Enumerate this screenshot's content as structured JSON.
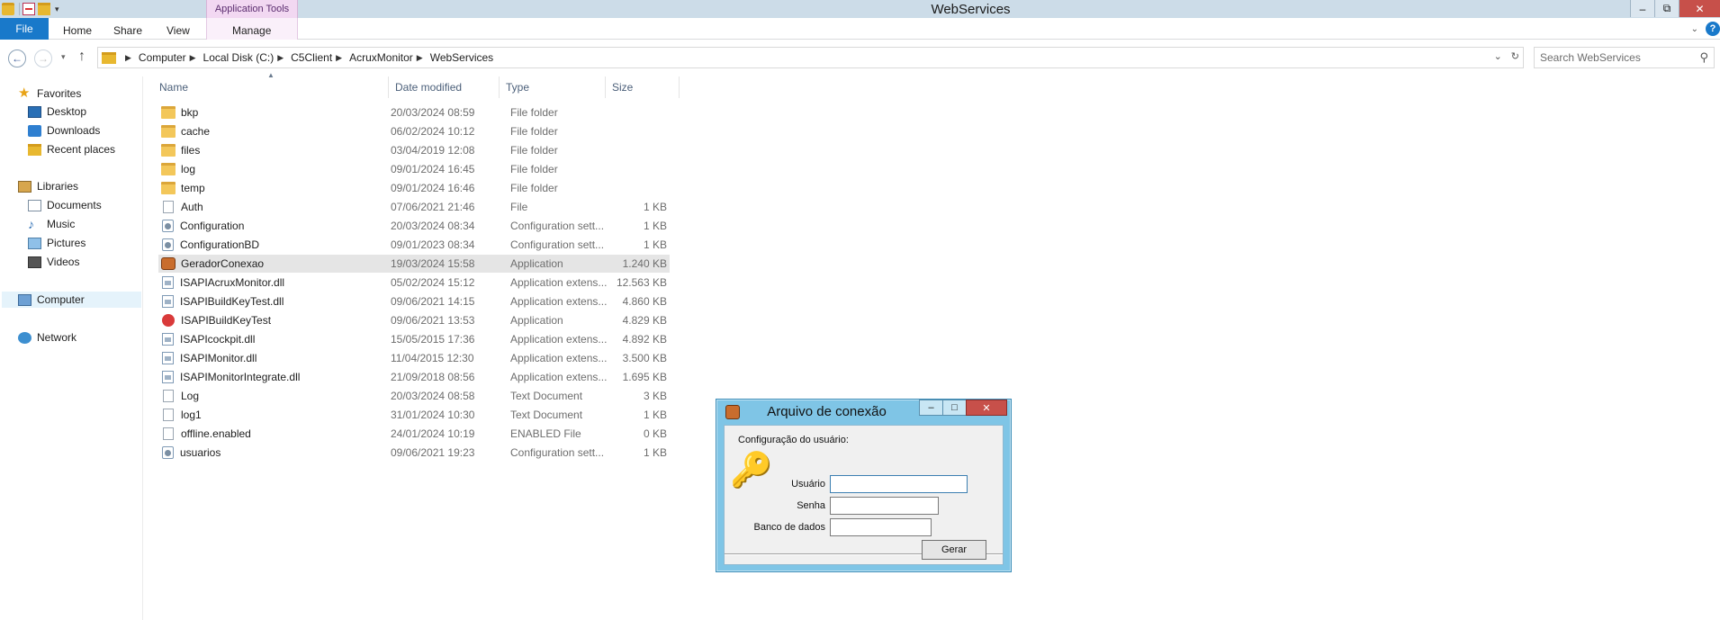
{
  "window": {
    "title": "WebServices",
    "context_tab_group": "Application Tools",
    "buttons": {
      "minimize": "‒",
      "restore": "⧉",
      "close": "✕"
    }
  },
  "ribbon": {
    "tabs": [
      {
        "label": "File"
      },
      {
        "label": "Home"
      },
      {
        "label": "Share"
      },
      {
        "label": "View"
      },
      {
        "label": "Manage"
      }
    ],
    "help": "?",
    "expand": "⌄"
  },
  "nav": {
    "back": "←",
    "forward": "→",
    "recent": "▾",
    "up": "↑",
    "breadcrumb": [
      "Computer",
      "Local Disk (C:)",
      "C5Client",
      "AcruxMonitor",
      "WebServices"
    ],
    "crumb_separator": "▶",
    "refresh": "↻",
    "dropdown": "⌄"
  },
  "search": {
    "placeholder": "Search WebServices",
    "icon": "search-icon"
  },
  "sidebar": {
    "items": [
      {
        "label": "Favorites",
        "icon": "star-icon"
      },
      {
        "label": "Desktop",
        "icon": "desktop-icon"
      },
      {
        "label": "Downloads",
        "icon": "downloads-icon"
      },
      {
        "label": "Recent places",
        "icon": "recent-places-icon"
      },
      {
        "label": "Libraries",
        "icon": "libraries-icon"
      },
      {
        "label": "Documents",
        "icon": "documents-icon"
      },
      {
        "label": "Music",
        "icon": "music-icon"
      },
      {
        "label": "Pictures",
        "icon": "pictures-icon"
      },
      {
        "label": "Videos",
        "icon": "videos-icon"
      },
      {
        "label": "Computer",
        "icon": "computer-icon"
      },
      {
        "label": "Network",
        "icon": "network-icon"
      }
    ]
  },
  "filelist": {
    "columns": [
      "Name",
      "Date modified",
      "Type",
      "Size"
    ],
    "sort_indicator": "▲",
    "rows": [
      {
        "name": "bkp",
        "date": "20/03/2024 08:59",
        "type": "File folder",
        "size": "",
        "icon": "folder"
      },
      {
        "name": "cache",
        "date": "06/02/2024 10:12",
        "type": "File folder",
        "size": "",
        "icon": "folder"
      },
      {
        "name": "files",
        "date": "03/04/2019 12:08",
        "type": "File folder",
        "size": "",
        "icon": "folder"
      },
      {
        "name": "log",
        "date": "09/01/2024 16:45",
        "type": "File folder",
        "size": "",
        "icon": "folder"
      },
      {
        "name": "temp",
        "date": "09/01/2024 16:46",
        "type": "File folder",
        "size": "",
        "icon": "folder"
      },
      {
        "name": "Auth",
        "date": "07/06/2021 21:46",
        "type": "File",
        "size": "1 KB",
        "icon": "file"
      },
      {
        "name": "Configuration",
        "date": "20/03/2024 08:34",
        "type": "Configuration sett...",
        "size": "1 KB",
        "icon": "config"
      },
      {
        "name": "ConfigurationBD",
        "date": "09/01/2023 08:34",
        "type": "Configuration sett...",
        "size": "1 KB",
        "icon": "config"
      },
      {
        "name": "GeradorConexao",
        "date": "19/03/2024 15:58",
        "type": "Application",
        "size": "1.240 KB",
        "icon": "app-key"
      },
      {
        "name": "ISAPIAcruxMonitor.dll",
        "date": "05/02/2024 15:12",
        "type": "Application extens...",
        "size": "12.563 KB",
        "icon": "dll"
      },
      {
        "name": "ISAPIBuildKeyTest.dll",
        "date": "09/06/2021 14:15",
        "type": "Application extens...",
        "size": "4.860 KB",
        "icon": "dll"
      },
      {
        "name": "ISAPIBuildKeyTest",
        "date": "09/06/2021 13:53",
        "type": "Application",
        "size": "4.829 KB",
        "icon": "app-red"
      },
      {
        "name": "ISAPIcockpit.dll",
        "date": "15/05/2015 17:36",
        "type": "Application extens...",
        "size": "4.892 KB",
        "icon": "dll"
      },
      {
        "name": "ISAPIMonitor.dll",
        "date": "11/04/2015 12:30",
        "type": "Application extens...",
        "size": "3.500 KB",
        "icon": "dll"
      },
      {
        "name": "ISAPIMonitorIntegrate.dll",
        "date": "21/09/2018 08:56",
        "type": "Application extens...",
        "size": "1.695 KB",
        "icon": "dll"
      },
      {
        "name": "Log",
        "date": "20/03/2024 08:58",
        "type": "Text Document",
        "size": "3 KB",
        "icon": "file"
      },
      {
        "name": "log1",
        "date": "31/01/2024 10:30",
        "type": "Text Document",
        "size": "1 KB",
        "icon": "file"
      },
      {
        "name": "offline.enabled",
        "date": "24/01/2024 10:19",
        "type": "ENABLED File",
        "size": "0 KB",
        "icon": "file"
      },
      {
        "name": "usuarios",
        "date": "09/06/2021 19:23",
        "type": "Configuration sett...",
        "size": "1 KB",
        "icon": "config"
      }
    ]
  },
  "dialog": {
    "title": "Arquivo de conexão",
    "heading": "Configuração do usuário:",
    "fields": [
      {
        "label": "Usuário",
        "value": ""
      },
      {
        "label": "Senha",
        "value": ""
      },
      {
        "label": "Banco de dados",
        "value": ""
      }
    ],
    "button": "Gerar",
    "controls": {
      "minimize": "‒",
      "maximize": "□",
      "close": "✕"
    },
    "icon": "key-icon"
  }
}
